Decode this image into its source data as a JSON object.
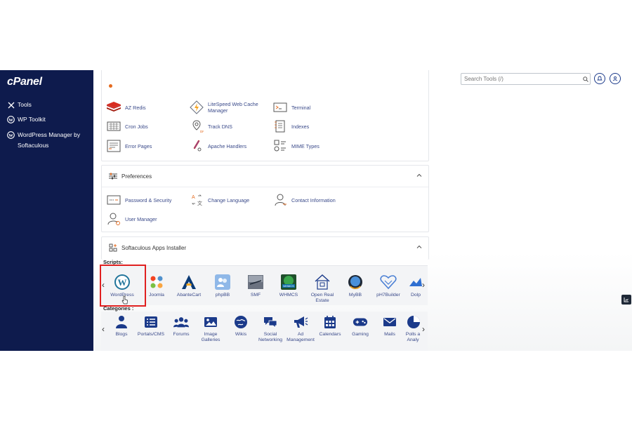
{
  "sidebar": {
    "logo": "cPanel",
    "items": [
      {
        "label": "Tools",
        "icon": "tools-icon"
      },
      {
        "label": "WP Toolkit",
        "icon": "wordpress-icon"
      },
      {
        "label": "WordPress Manager by Softaculous",
        "icon": "wordpress-icon"
      }
    ]
  },
  "header": {
    "search_placeholder": "Search Tools (/)"
  },
  "advanced": {
    "tools": [
      {
        "label": "AZ Redis",
        "icon": "redis-icon"
      },
      {
        "label": "LiteSpeed Web Cache Manager",
        "icon": "litespeed-icon"
      },
      {
        "label": "Terminal",
        "icon": "terminal-icon"
      },
      {
        "label": "Cron Jobs",
        "icon": "cron-jobs-icon"
      },
      {
        "label": "Track DNS",
        "icon": "track-dns-icon"
      },
      {
        "label": "Indexes",
        "icon": "indexes-icon"
      },
      {
        "label": "Error Pages",
        "icon": "error-pages-icon"
      },
      {
        "label": "Apache Handlers",
        "icon": "apache-handlers-icon"
      },
      {
        "label": "MIME Types",
        "icon": "mime-types-icon"
      }
    ]
  },
  "preferences": {
    "title": "Preferences",
    "tools": [
      {
        "label": "Password & Security",
        "icon": "password-icon"
      },
      {
        "label": "Change Language",
        "icon": "language-icon"
      },
      {
        "label": "Contact Information",
        "icon": "contact-icon"
      },
      {
        "label": "User Manager",
        "icon": "user-manager-icon"
      }
    ]
  },
  "softaculous": {
    "title": "Softaculous Apps Installer",
    "scripts_label": "Scripts:",
    "categories_label": "Categories :",
    "scripts": [
      {
        "label": "WordPress",
        "icon": "wordpress-icon"
      },
      {
        "label": "Joomla",
        "icon": "joomla-icon"
      },
      {
        "label": "AbanteCart",
        "icon": "abantecart-icon"
      },
      {
        "label": "phpBB",
        "icon": "phpbb-icon"
      },
      {
        "label": "SMF",
        "icon": "smf-icon"
      },
      {
        "label": "WHMCS",
        "icon": "whmcs-icon"
      },
      {
        "label": "Open Real Estate",
        "icon": "open-real-estate-icon"
      },
      {
        "label": "MyBB",
        "icon": "mybb-icon"
      },
      {
        "label": "pH7Builder",
        "icon": "ph7builder-icon"
      },
      {
        "label": "Dolp",
        "icon": "dolphin-icon"
      }
    ],
    "categories": [
      {
        "label": "Blogs",
        "icon": "blogs-icon"
      },
      {
        "label": "Portals/CMS",
        "icon": "portals-icon"
      },
      {
        "label": "Forums",
        "icon": "forums-icon"
      },
      {
        "label": "Image Galleries",
        "icon": "image-galleries-icon"
      },
      {
        "label": "Wikis",
        "icon": "wikis-icon"
      },
      {
        "label": "Social Networking",
        "icon": "social-networking-icon"
      },
      {
        "label": "Ad Management",
        "icon": "ad-management-icon"
      },
      {
        "label": "Calendars",
        "icon": "calendars-icon"
      },
      {
        "label": "Gaming",
        "icon": "gaming-icon"
      },
      {
        "label": "Mails",
        "icon": "mails-icon"
      },
      {
        "label": "Polls a Analy",
        "icon": "polls-icon"
      }
    ]
  },
  "colors": {
    "sidebar_bg": "#0e1b4d",
    "accent": "#1b3a8a",
    "link": "#3a4a8a",
    "highlight": "#e02020"
  }
}
